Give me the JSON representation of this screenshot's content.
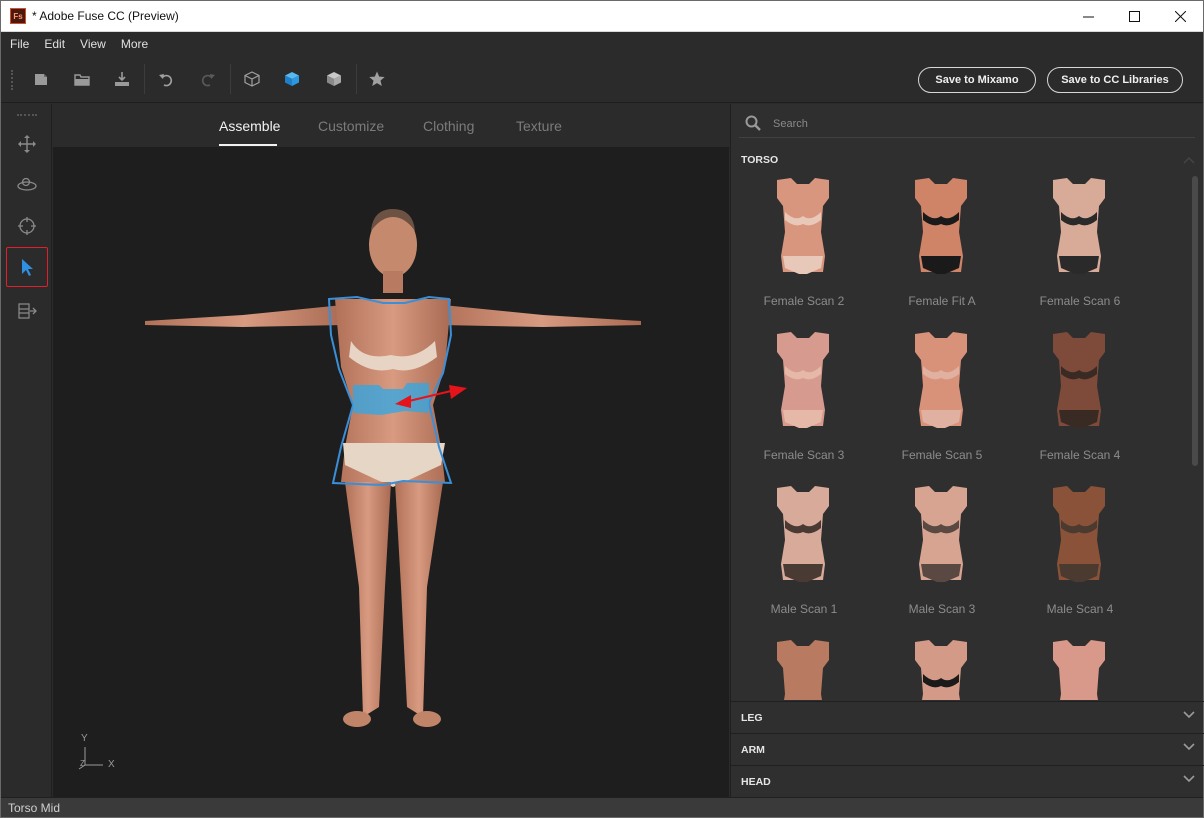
{
  "window": {
    "title": "* Adobe Fuse CC (Preview)",
    "logo_text": "Fs",
    "controls": {
      "minimize": "—",
      "maximize": "☐",
      "close": "✕"
    }
  },
  "menu": {
    "items": [
      "File",
      "Edit",
      "View",
      "More"
    ]
  },
  "toolbar": {
    "icons": [
      "new-file-icon",
      "open-folder-icon",
      "import-icon",
      "undo-icon",
      "redo-icon",
      "wireframe-cube-icon",
      "solid-cube-icon",
      "textured-cube-icon",
      "favorite-star-icon"
    ],
    "save_mixamo": "Save to Mixamo",
    "save_cc": "Save to CC Libraries"
  },
  "left_tools": [
    "move-tool-icon",
    "orbit-tool-icon",
    "target-tool-icon",
    "select-tool-icon",
    "morph-tool-icon"
  ],
  "viewport": {
    "tabs": [
      {
        "label": "Assemble",
        "active": true
      },
      {
        "label": "Customize",
        "active": false
      },
      {
        "label": "Clothing",
        "active": false
      },
      {
        "label": "Texture",
        "active": false
      }
    ],
    "axis": {
      "y": "Y",
      "x": "X",
      "z": "Z"
    },
    "selection_color": "#3a8fd8",
    "arrow_color": "#e5141a"
  },
  "panel": {
    "search_placeholder": "Search",
    "sections": {
      "torso": "TORSO",
      "leg": "LEG",
      "arm": "ARM",
      "head": "HEAD"
    },
    "torso_items": [
      {
        "label": "Female Scan 2",
        "skin": "#d9967e",
        "garment": "#e8c8b8"
      },
      {
        "label": "Female Fit A",
        "skin": "#cf8468",
        "garment": "#1a1a1a"
      },
      {
        "label": "Female Scan 6",
        "skin": "#d7ab98",
        "garment": "#2a2a2a"
      },
      {
        "label": "Female Scan 3",
        "skin": "#d69a8e",
        "garment": "#e6b8a8"
      },
      {
        "label": "Female Scan 5",
        "skin": "#d9927a",
        "garment": "#e0b0a0"
      },
      {
        "label": "Female Scan 4",
        "skin": "#7e4a3a",
        "garment": "#3a2a24"
      },
      {
        "label": "Male Scan 1",
        "skin": "#d7aa9a",
        "garment": "#4a3a34"
      },
      {
        "label": "Male Scan 3",
        "skin": "#d7a492",
        "garment": "#5a4842"
      },
      {
        "label": "Male Scan 4",
        "skin": "#8a5238",
        "garment": "#4a3a30"
      },
      {
        "label": "",
        "skin": "#b87a60",
        "garment": "#b87a60"
      },
      {
        "label": "",
        "skin": "#d49a88",
        "garment": "#1a1a1a"
      },
      {
        "label": "",
        "skin": "#d8988a",
        "garment": "#d8988a"
      }
    ]
  },
  "status": {
    "text": "Torso Mid"
  }
}
